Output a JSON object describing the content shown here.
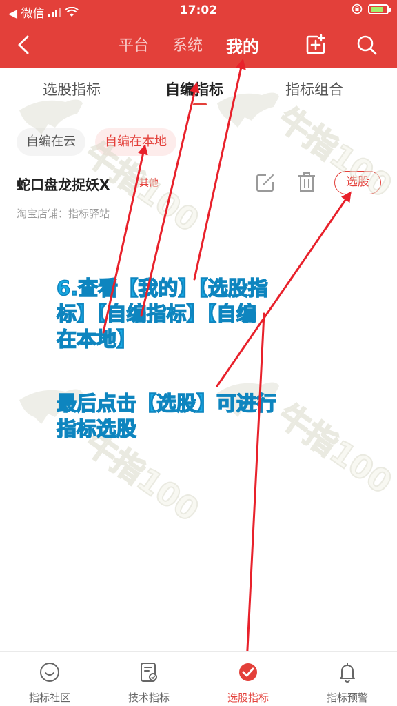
{
  "status_bar": {
    "back_app": "◀ 微信",
    "time": "17:02"
  },
  "nav": {
    "tabs": [
      {
        "label": "平台"
      },
      {
        "label": "系统"
      },
      {
        "label": "我的"
      }
    ],
    "active_tab": 2
  },
  "sub_tabs": [
    {
      "label": "选股指标"
    },
    {
      "label": "自编指标"
    },
    {
      "label": "指标组合"
    }
  ],
  "chips": [
    {
      "label": "自编在云"
    },
    {
      "label": "自编在本地"
    }
  ],
  "item": {
    "title": "蛇口盘龙捉妖X",
    "tag": "其他",
    "select_label": "选股",
    "shop": "淘宝店铺：指标驿站"
  },
  "annotation": {
    "line1": "6.查看【我的】【选股指",
    "line2": "标】【自编指标】【自编",
    "line3": "在本地】",
    "line4": "最后点击【选股】可进行",
    "line5": "指标选股"
  },
  "tab_bar": [
    {
      "label": "指标社区",
      "icon": "chat-smile-icon"
    },
    {
      "label": "技术指标",
      "icon": "chart-doc-icon"
    },
    {
      "label": "选股指标",
      "icon": "check-circle-icon"
    },
    {
      "label": "指标预警",
      "icon": "bell-icon"
    }
  ],
  "colors": {
    "brand_red": "#e3403a",
    "annotation_blue": "#19a9e3",
    "battery_green": "#a4f06c"
  }
}
